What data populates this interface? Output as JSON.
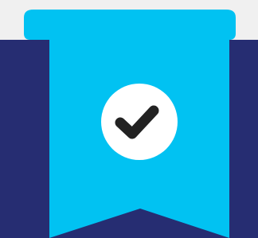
{
  "colors": {
    "top_band": "#f0f0f0",
    "backdrop": "#262d72",
    "ribbon": "#01c2f2",
    "badge_circle": "#ffffff",
    "checkmark": "#222222"
  },
  "icons": {
    "badge": "ribbon-bookmark-icon",
    "check": "checkmark-icon"
  }
}
